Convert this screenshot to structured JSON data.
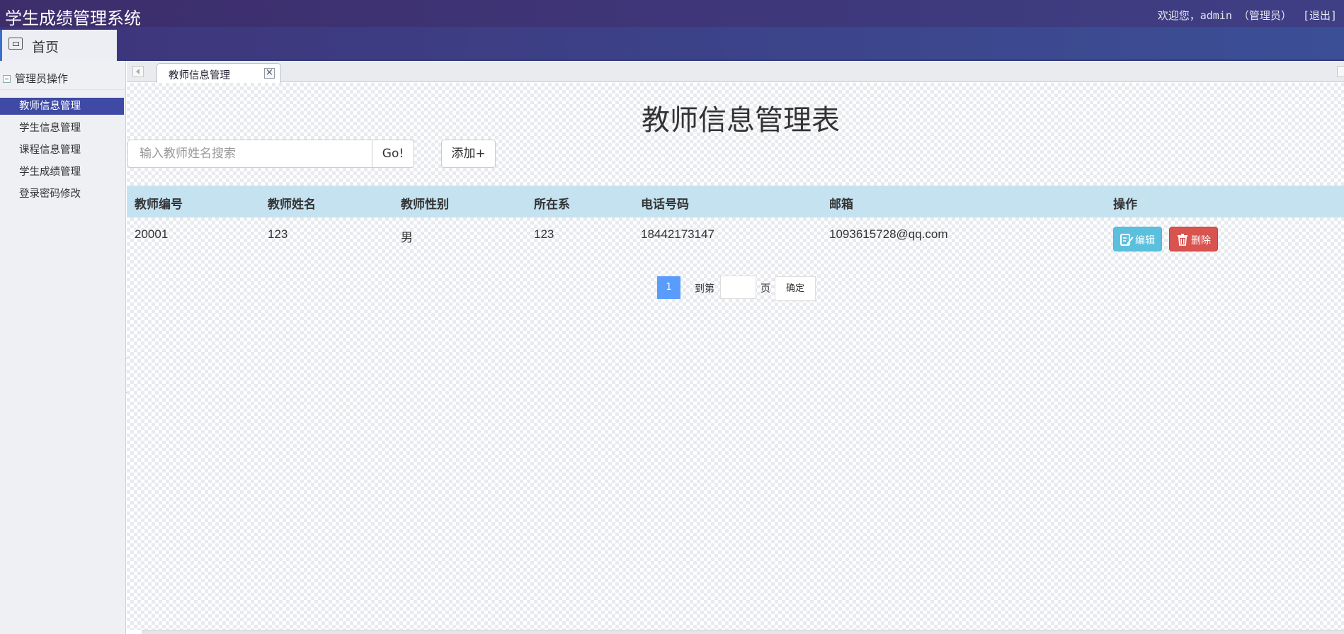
{
  "header": {
    "app_title": "学生成绩管理系统",
    "welcome": "欢迎您，admin （管理员）",
    "logout": "[退出]"
  },
  "nav": {
    "home_label": "首页",
    "home_icon": "home-window-icon"
  },
  "sidebar": {
    "group_label": "管理员操作",
    "items": [
      {
        "label": "教师信息管理",
        "active": true
      },
      {
        "label": "学生信息管理",
        "active": false
      },
      {
        "label": "课程信息管理",
        "active": false
      },
      {
        "label": "学生成绩管理",
        "active": false
      },
      {
        "label": "登录密码修改",
        "active": false
      }
    ]
  },
  "tabs": [
    {
      "label": "教师信息管理",
      "close": "×"
    }
  ],
  "main": {
    "title": "教师信息管理表",
    "search_placeholder": "输入教师姓名搜索",
    "go_label": "Go!",
    "add_label": "添加+",
    "columns": [
      "教师编号",
      "教师姓名",
      "教师性别",
      "所在系",
      "电话号码",
      "邮箱",
      "操作"
    ],
    "rows": [
      {
        "id": "20001",
        "name": "123",
        "gender": "男",
        "dept": "123",
        "phone": "18442173147",
        "email": "1093615728@qq.com"
      }
    ],
    "actions": {
      "edit": "编辑",
      "delete": "删除"
    }
  },
  "pagination": {
    "current_page": "1",
    "goto_label": "到第",
    "page_unit": "页",
    "confirm_label": "确定"
  },
  "colors": {
    "header_bg": "#3d2d6b",
    "sidebar_active": "#3e4aa3",
    "table_header": "#c5e2f1",
    "edit_btn": "#5bc0de",
    "delete_btn": "#d9534f",
    "page_active": "#5a9cfc"
  }
}
